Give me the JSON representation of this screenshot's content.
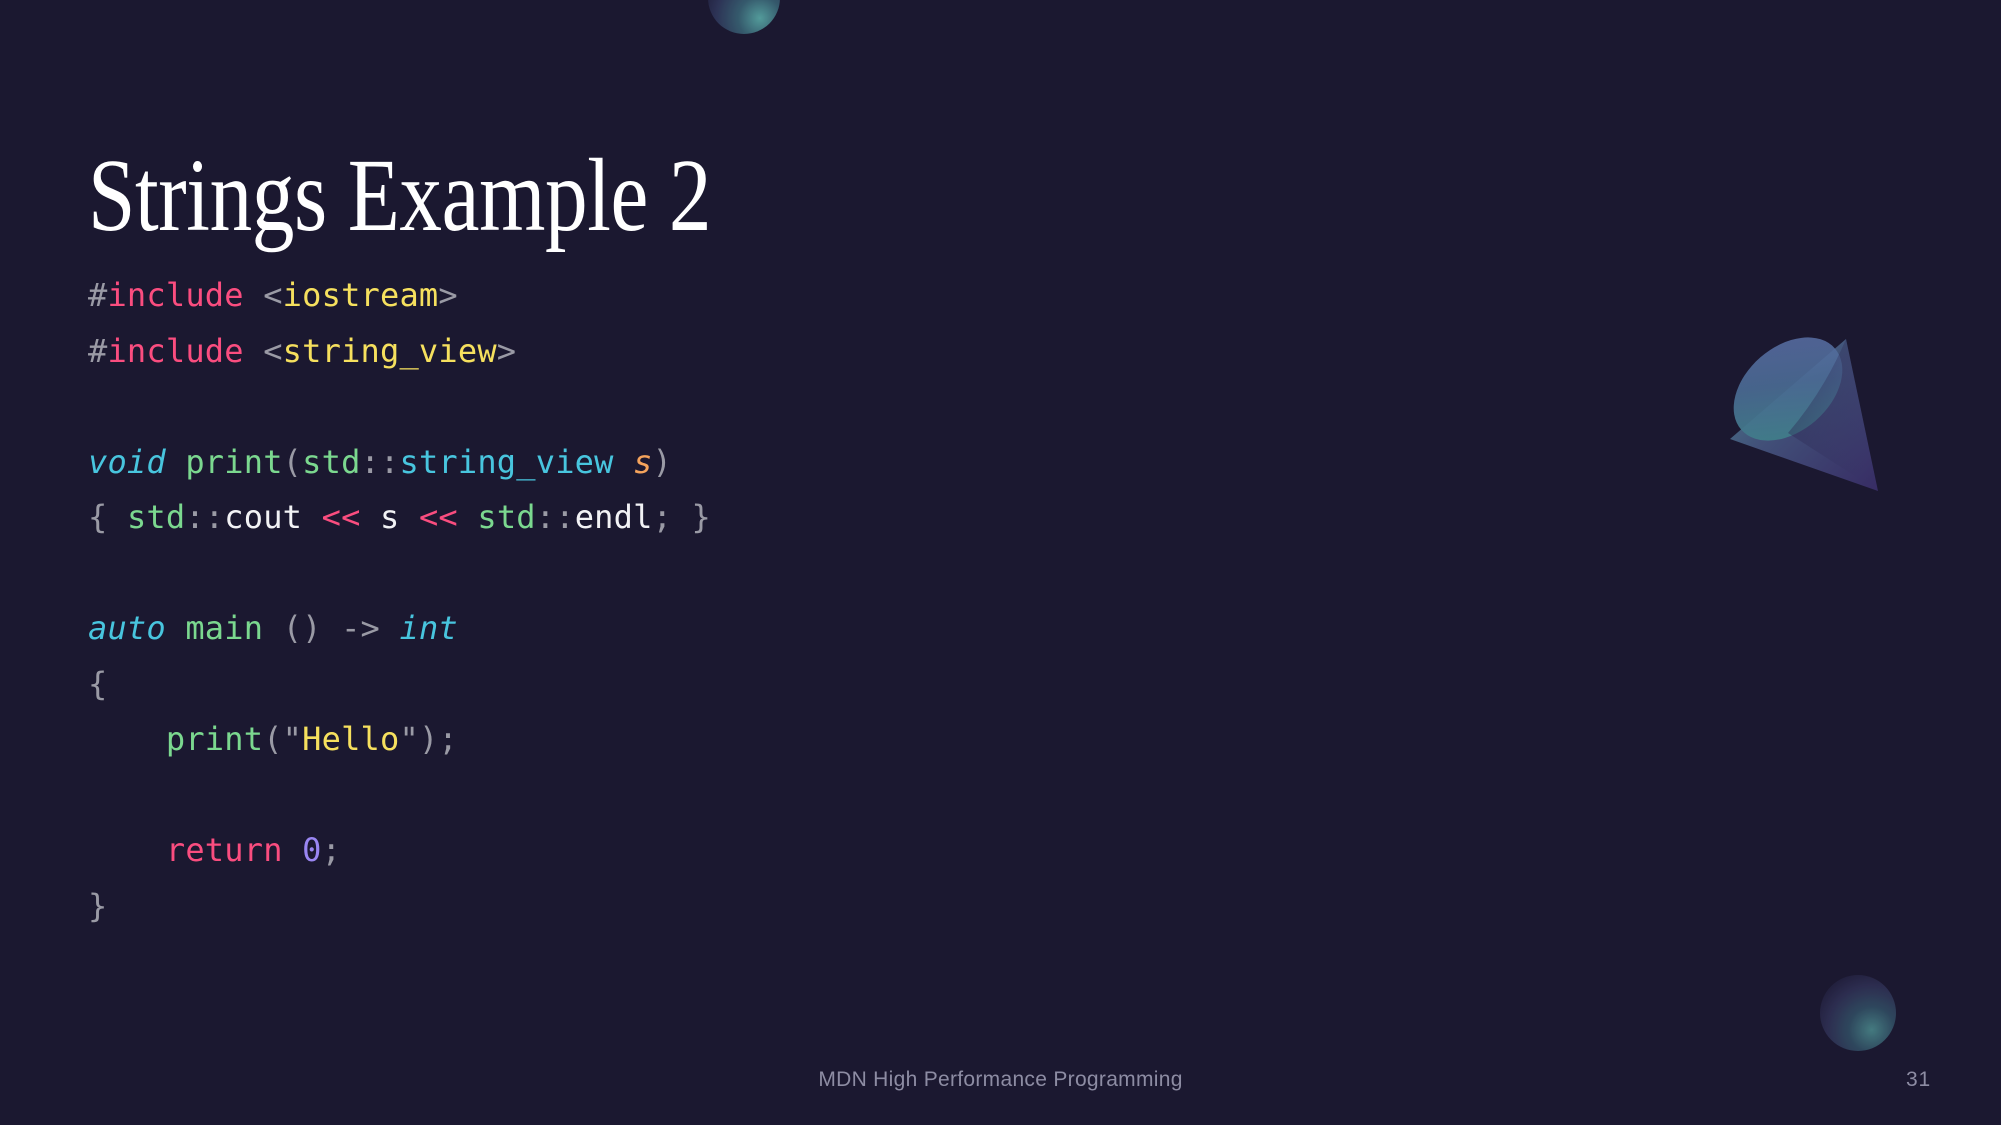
{
  "slide": {
    "background_color": "#1b1830",
    "title": "Strings Example 2",
    "page_number": "31",
    "footer": "MDN High Performance Programming"
  },
  "theme": {
    "title_color": "#ffffff",
    "footer_color": "#8d8ca3",
    "code_punctuation": "#9a9aa5",
    "code_preprocessor": "#fa4d7f",
    "code_string": "#f6e05e",
    "code_keyword": "#48c5de",
    "code_function": "#7bd88f",
    "code_namespace": "#7bd88f",
    "code_type": "#48c5de",
    "code_parameter": "#f5a35c",
    "code_plain": "#f2f2f5",
    "code_operator": "#fa4d7f",
    "code_number": "#9a86f2"
  },
  "code": {
    "language": "cpp",
    "plain_text": "#include <iostream>\n#include <string_view>\n\nvoid print(std::string_view s)\n{ std::cout << s << std::endl; }\n\nauto main () -> int\n{\n    print(\"Hello\");\n\n    return 0;\n}",
    "lines": [
      {
        "tokens": [
          {
            "text": "#",
            "type": "punc"
          },
          {
            "text": "include",
            "type": "pre"
          },
          {
            "text": " ",
            "type": "plainspace"
          },
          {
            "text": "<",
            "type": "punc"
          },
          {
            "text": "iostream",
            "type": "str"
          },
          {
            "text": ">",
            "type": "punc"
          }
        ]
      },
      {
        "tokens": [
          {
            "text": "#",
            "type": "punc"
          },
          {
            "text": "include",
            "type": "pre"
          },
          {
            "text": " ",
            "type": "plainspace"
          },
          {
            "text": "<",
            "type": "punc"
          },
          {
            "text": "string_view",
            "type": "str"
          },
          {
            "text": ">",
            "type": "punc"
          }
        ]
      },
      {
        "tokens": []
      },
      {
        "tokens": [
          {
            "text": "void",
            "type": "kw"
          },
          {
            "text": " ",
            "type": "plainspace"
          },
          {
            "text": "print",
            "type": "fn"
          },
          {
            "text": "(",
            "type": "punc"
          },
          {
            "text": "std",
            "type": "ns"
          },
          {
            "text": "::",
            "type": "punc"
          },
          {
            "text": "string_view",
            "type": "type"
          },
          {
            "text": " ",
            "type": "plainspace"
          },
          {
            "text": "s",
            "type": "param"
          },
          {
            "text": ")",
            "type": "punc"
          }
        ]
      },
      {
        "tokens": [
          {
            "text": "{ ",
            "type": "punc"
          },
          {
            "text": "std",
            "type": "ns"
          },
          {
            "text": "::",
            "type": "punc"
          },
          {
            "text": "cout",
            "type": "plain"
          },
          {
            "text": " ",
            "type": "plainspace"
          },
          {
            "text": "<<",
            "type": "op"
          },
          {
            "text": " ",
            "type": "plainspace"
          },
          {
            "text": "s",
            "type": "plain"
          },
          {
            "text": " ",
            "type": "plainspace"
          },
          {
            "text": "<<",
            "type": "op"
          },
          {
            "text": " ",
            "type": "plainspace"
          },
          {
            "text": "std",
            "type": "ns"
          },
          {
            "text": "::",
            "type": "punc"
          },
          {
            "text": "endl",
            "type": "plain"
          },
          {
            "text": "; }",
            "type": "punc"
          }
        ]
      },
      {
        "tokens": []
      },
      {
        "tokens": [
          {
            "text": "auto",
            "type": "kw"
          },
          {
            "text": " ",
            "type": "plainspace"
          },
          {
            "text": "main",
            "type": "fn"
          },
          {
            "text": " ",
            "type": "plainspace"
          },
          {
            "text": "()",
            "type": "punc"
          },
          {
            "text": " ",
            "type": "plainspace"
          },
          {
            "text": "->",
            "type": "punc"
          },
          {
            "text": " ",
            "type": "plainspace"
          },
          {
            "text": "int",
            "type": "kw"
          }
        ]
      },
      {
        "tokens": [
          {
            "text": "{",
            "type": "punc"
          }
        ]
      },
      {
        "tokens": [
          {
            "text": "    ",
            "type": "plainspace"
          },
          {
            "text": "print",
            "type": "fn"
          },
          {
            "text": "(",
            "type": "punc"
          },
          {
            "text": "\"",
            "type": "punc"
          },
          {
            "text": "Hello",
            "type": "str"
          },
          {
            "text": "\"",
            "type": "punc"
          },
          {
            "text": ");",
            "type": "punc"
          }
        ]
      },
      {
        "tokens": []
      },
      {
        "tokens": [
          {
            "text": "    ",
            "type": "plainspace"
          },
          {
            "text": "return",
            "type": "ret"
          },
          {
            "text": " ",
            "type": "plainspace"
          },
          {
            "text": "0",
            "type": "num"
          },
          {
            "text": ";",
            "type": "punc"
          }
        ]
      },
      {
        "tokens": [
          {
            "text": "}",
            "type": "punc"
          }
        ]
      }
    ]
  },
  "decorations": [
    {
      "name": "sphere-top",
      "shape": "sphere"
    },
    {
      "name": "cone",
      "shape": "cone"
    },
    {
      "name": "sphere-bottom",
      "shape": "sphere"
    }
  ]
}
